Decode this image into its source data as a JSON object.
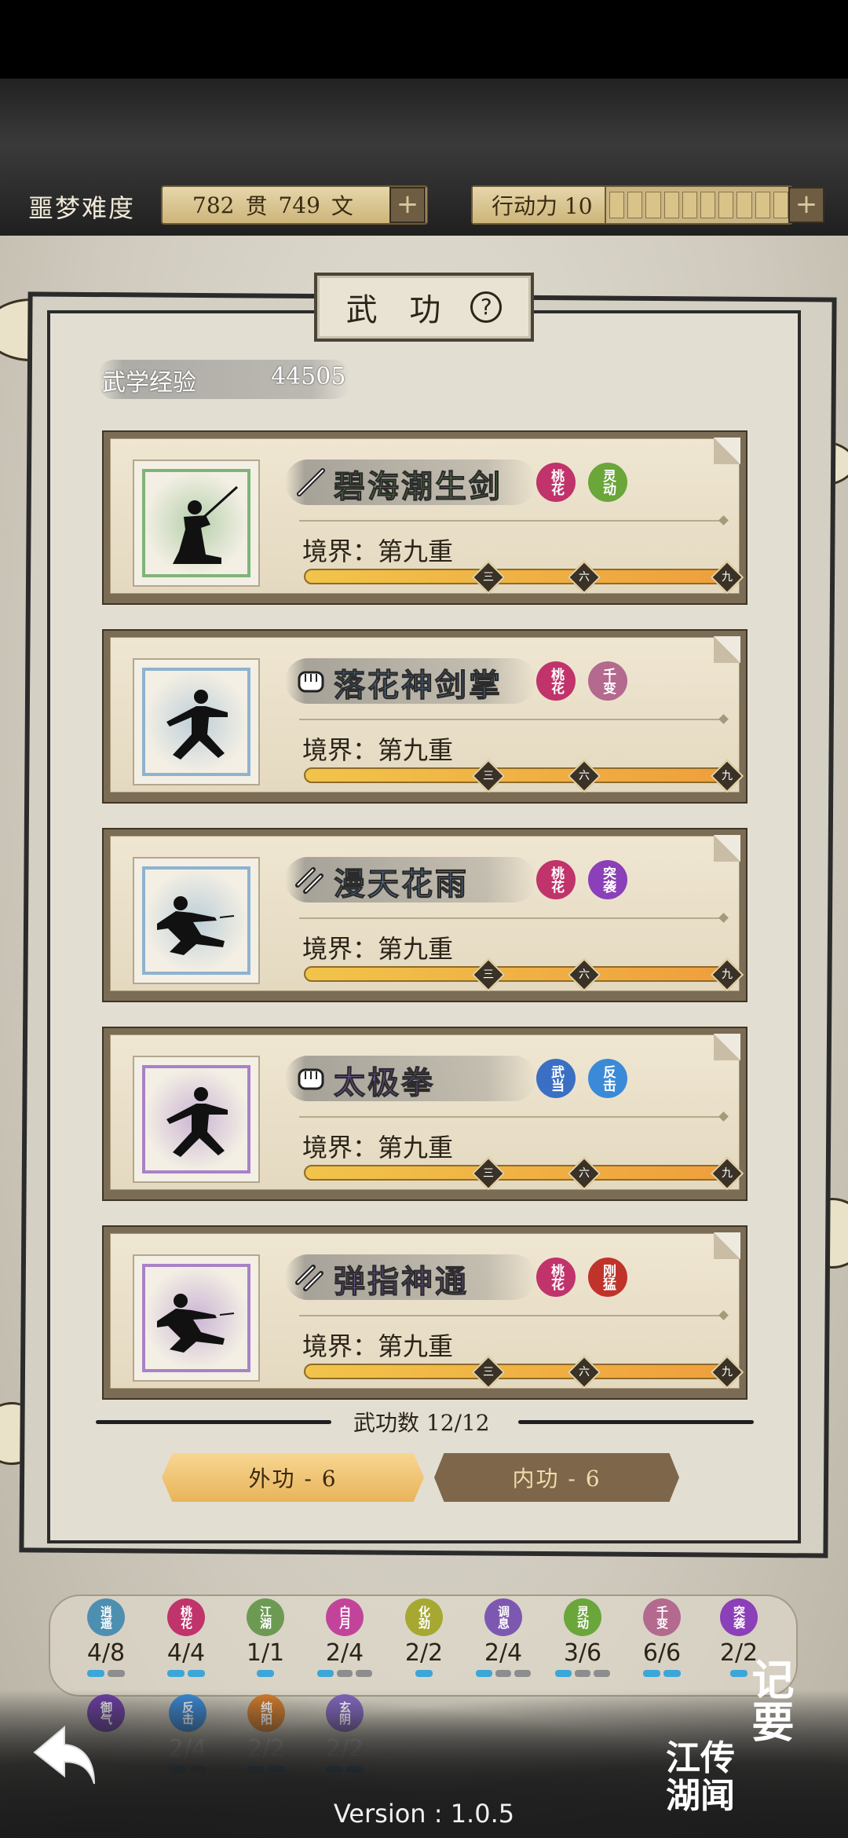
{
  "header": {
    "difficulty": "噩梦难度",
    "money": {
      "guan_value": "782",
      "guan_unit": "贯",
      "wen_value": "749",
      "wen_unit": "文"
    },
    "action_power_label": "行动力 10",
    "action_power_value": 10
  },
  "panel": {
    "title": "武 功",
    "exp_label": "武学经验",
    "exp_value": "44505"
  },
  "skills": [
    {
      "name": "碧海潮生剑",
      "name_color": "#5f8e4b",
      "weapon": "sword-icon",
      "frame_color": "#7fb479",
      "pose": "sword",
      "realm": "境界：第九重",
      "progress": 1.0,
      "tags": [
        {
          "text": "桃花",
          "color": "#c0336b"
        },
        {
          "text": "灵动",
          "color": "#6aa63a"
        }
      ]
    },
    {
      "name": "落花神剑掌",
      "name_color": "#5b7ea5",
      "weapon": "fist-icon",
      "frame_color": "#8fb2cf",
      "pose": "palm",
      "realm": "境界：第九重",
      "progress": 1.0,
      "tags": [
        {
          "text": "桃花",
          "color": "#c0336b"
        },
        {
          "text": "千变",
          "color": "#b36a8e"
        }
      ]
    },
    {
      "name": "漫天花雨",
      "name_color": "#5b7ea5",
      "weapon": "dart-icon",
      "frame_color": "#8fb2cf",
      "pose": "throw",
      "realm": "境界：第九重",
      "progress": 1.0,
      "tags": [
        {
          "text": "桃花",
          "color": "#c0336b"
        },
        {
          "text": "突袭",
          "color": "#8b3fb8"
        }
      ]
    },
    {
      "name": "太极拳",
      "name_color": "#7c5aa8",
      "weapon": "fist-icon",
      "frame_color": "#a882c7",
      "pose": "palm",
      "realm": "境界：第九重",
      "progress": 1.0,
      "tags": [
        {
          "text": "武当",
          "color": "#3a6fc4"
        },
        {
          "text": "反击",
          "color": "#3a8ad8"
        }
      ]
    },
    {
      "name": "弹指神通",
      "name_color": "#7c5aa8",
      "weapon": "dart-icon",
      "frame_color": "#a882c7",
      "pose": "throw",
      "realm": "境界：第九重",
      "progress": 1.0,
      "tags": [
        {
          "text": "桃花",
          "color": "#c0336b"
        },
        {
          "text": "刚猛",
          "color": "#c0332b"
        }
      ]
    }
  ],
  "progress_markers": [
    "三",
    "六",
    "九"
  ],
  "skill_count": "武功数 12/12",
  "tabs": {
    "outer": "外功 - 6",
    "inner": "内功 - 6"
  },
  "talents_row1": [
    {
      "text": "逍遥",
      "value": "4/8",
      "color": "#4d8fb0",
      "pips": [
        1,
        0
      ]
    },
    {
      "text": "桃花",
      "value": "4/4",
      "color": "#c0336b",
      "pips": [
        1,
        1
      ]
    },
    {
      "text": "江湖",
      "value": "1/1",
      "color": "#6c9a52",
      "pips": [
        1
      ]
    },
    {
      "text": "白月",
      "value": "2/4",
      "color": "#c2449a",
      "pips": [
        1,
        0,
        0
      ]
    },
    {
      "text": "化劲",
      "value": "2/2",
      "color": "#a7a832",
      "pips": [
        1
      ]
    },
    {
      "text": "调息",
      "value": "2/4",
      "color": "#7d58b0",
      "pips": [
        1,
        0,
        0
      ]
    },
    {
      "text": "灵动",
      "value": "3/6",
      "color": "#6aa63a",
      "pips": [
        1,
        0,
        0
      ]
    },
    {
      "text": "千变",
      "value": "6/6",
      "color": "#b36a8e",
      "pips": [
        1,
        1
      ]
    },
    {
      "text": "突袭",
      "value": "2/2",
      "color": "#8b3fb8",
      "pips": [
        1
      ]
    }
  ],
  "talents_row2": [
    {
      "text": "御气",
      "value": "",
      "color": "#6d3fa8",
      "pips": []
    },
    {
      "text": "反击",
      "value": "2/4",
      "color": "#3a8ad8",
      "pips": [
        1,
        0
      ]
    },
    {
      "text": "纯阳",
      "value": "2/2",
      "color": "#d07b2c",
      "pips": [
        1,
        1
      ]
    },
    {
      "text": "玄阴",
      "value": "2/2",
      "color": "#7d63b8",
      "pips": [
        1,
        1
      ]
    }
  ],
  "corner": {
    "notes": "记要",
    "rumors_line1": "江传",
    "rumors_line2": "湖闻"
  },
  "version": "Version : 1.0.5"
}
